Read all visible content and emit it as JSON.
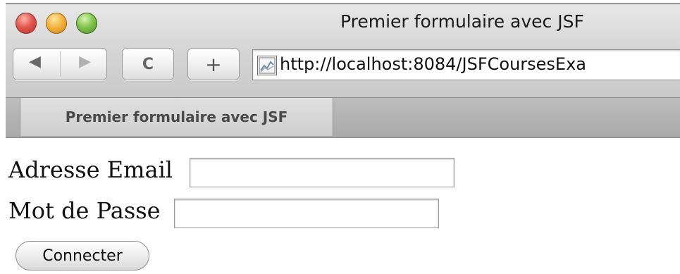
{
  "window": {
    "title": "Premier formulaire avec JSF"
  },
  "toolbar": {
    "back_icon": "◀",
    "forward_icon": "▶",
    "reload_icon": "C",
    "add_icon": "+",
    "url": "http://localhost:8084/JSFCoursesExa"
  },
  "tabs": [
    {
      "label": "Premier formulaire avec JSF"
    }
  ],
  "form": {
    "email_label": "Adresse Email",
    "email_value": "",
    "password_label": "Mot de Passe",
    "password_value": "",
    "submit_label": "Connecter"
  },
  "colors": {
    "close": "#e2544a",
    "minimize": "#f3b23b",
    "zoom": "#7fc34b"
  }
}
